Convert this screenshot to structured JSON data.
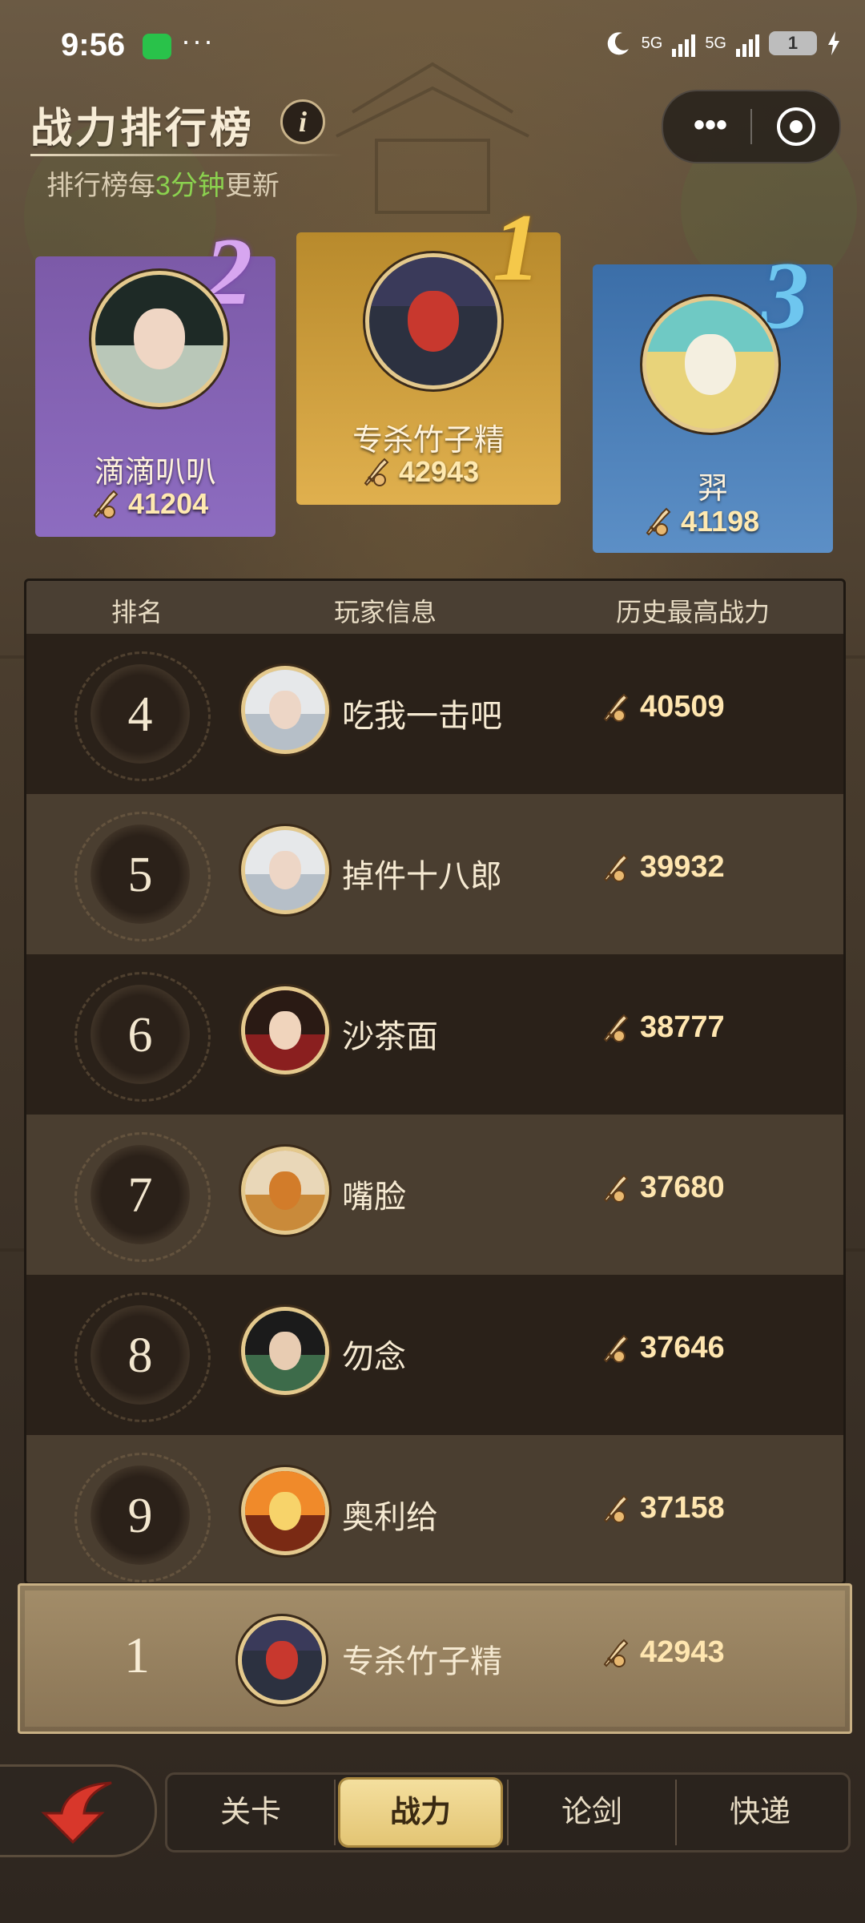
{
  "status_bar": {
    "time": "9:56",
    "more": "···",
    "net1": "5G",
    "net2": "5G",
    "battery": "1",
    "icons": [
      "wechat-icon",
      "moon-icon",
      "signal-icon",
      "battery-icon",
      "charging-icon"
    ]
  },
  "header": {
    "title": "战力排行榜",
    "info_label": "i",
    "subtitle_prefix": "排行榜每",
    "subtitle_highlight": "3分钟",
    "subtitle_suffix": "更新",
    "capsule_more": "•••"
  },
  "podium": [
    {
      "rank": "2",
      "name": "滴滴叭叭",
      "power": "41204",
      "color": "#8d6cc0"
    },
    {
      "rank": "1",
      "name": "专杀竹子精",
      "power": "42943",
      "color": "#e0b04e"
    },
    {
      "rank": "3",
      "name": "羿",
      "power": "41198",
      "color": "#5c8fc6"
    }
  ],
  "table": {
    "headers": {
      "rank": "排名",
      "player": "玩家信息",
      "power": "历史最高战力"
    },
    "rows": [
      {
        "rank": "4",
        "name": "吃我一击吧",
        "power": "40509"
      },
      {
        "rank": "5",
        "name": "掉件十八郎",
        "power": "39932"
      },
      {
        "rank": "6",
        "name": "沙茶面",
        "power": "38777"
      },
      {
        "rank": "7",
        "name": "嘴脸",
        "power": "37680"
      },
      {
        "rank": "8",
        "name": "勿念",
        "power": "37646"
      },
      {
        "rank": "9",
        "name": "奥利给",
        "power": "37158"
      }
    ]
  },
  "my_rank": {
    "rank": "1",
    "name": "专杀竹子精",
    "power": "42943"
  },
  "nav": {
    "tabs": [
      "关卡",
      "战力",
      "论剑",
      "快递"
    ],
    "selected": "战力"
  },
  "colors": {
    "accent_gold": "#e3c574",
    "highlight_green": "#8bd24f"
  }
}
